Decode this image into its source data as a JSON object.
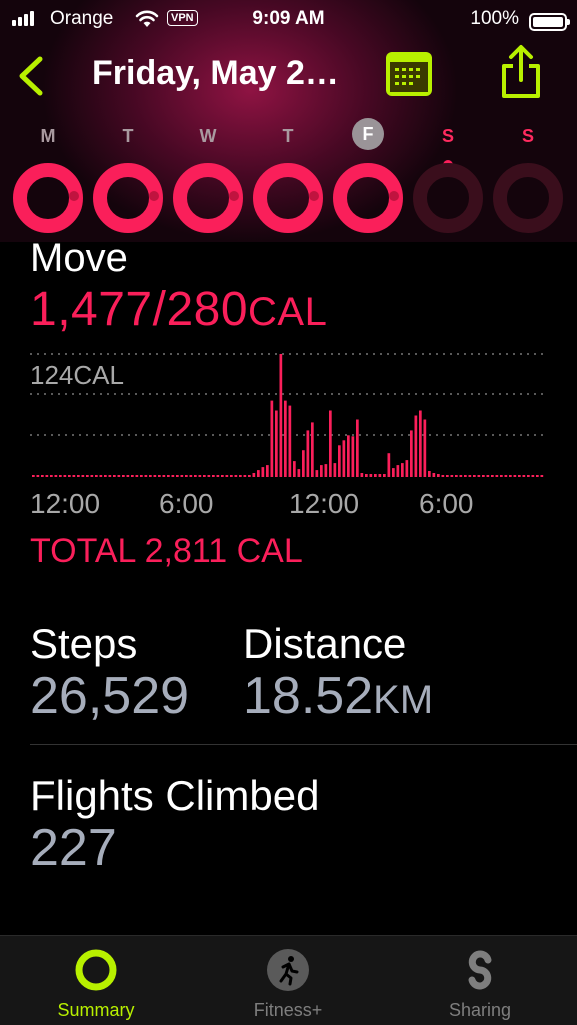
{
  "status_bar": {
    "carrier": "Orange",
    "vpn": "VPN",
    "time": "9:09 AM",
    "battery": "100%"
  },
  "nav": {
    "title": "Friday, May 2…"
  },
  "week": {
    "days": [
      "M",
      "T",
      "W",
      "T",
      "F",
      "S",
      "S"
    ],
    "ring_progress": [
      1,
      1,
      1,
      1,
      1,
      0,
      0
    ],
    "selected_index": 4,
    "colors": {
      "ring": "#fa1f5a",
      "ring_empty": "#3a0e1c"
    }
  },
  "move": {
    "title": "Move",
    "value": "1,477/280",
    "unit": "CAL",
    "chart_max_label": "124CAL",
    "x_labels": [
      "12:00",
      "6:00",
      "12:00",
      "6:00"
    ],
    "total": "TOTAL 2,811 CAL"
  },
  "chart_data": {
    "type": "bar",
    "title": "",
    "ylabel": "",
    "xlabel": "",
    "y_max_label": "124CAL",
    "ylim": [
      0,
      124
    ],
    "x_tick_labels": [
      "12:00",
      "6:00",
      "12:00",
      "6:00"
    ],
    "values": [
      2,
      2,
      2,
      2,
      2,
      2,
      2,
      2,
      2,
      2,
      2,
      2,
      2,
      2,
      2,
      2,
      2,
      2,
      2,
      2,
      2,
      2,
      2,
      2,
      2,
      2,
      2,
      2,
      2,
      2,
      2,
      2,
      2,
      2,
      2,
      2,
      2,
      2,
      2,
      2,
      2,
      2,
      2,
      2,
      2,
      2,
      2,
      2,
      2,
      4,
      7,
      10,
      12,
      77,
      67,
      124,
      77,
      72,
      16,
      8,
      27,
      47,
      55,
      7,
      12,
      13,
      67,
      14,
      32,
      37,
      42,
      41,
      58,
      4,
      3,
      3,
      3,
      3,
      3,
      24,
      9,
      12,
      14,
      17,
      47,
      62,
      67,
      58,
      6,
      4,
      3,
      2,
      2,
      2,
      2,
      2,
      2,
      2,
      2,
      2,
      2,
      2,
      2,
      2,
      2,
      2,
      2,
      2,
      2,
      2,
      2,
      2,
      2,
      2
    ],
    "color": "#fa1f5a"
  },
  "activity": {
    "steps_label": "Steps",
    "steps_value": "26,529",
    "distance_label": "Distance",
    "distance_value": "18.52",
    "distance_unit": "KM",
    "flights_label": "Flights Climbed",
    "flights_value": "227"
  },
  "tabs": [
    {
      "label": "Summary",
      "icon": "summary-ring-icon",
      "active": true
    },
    {
      "label": "Fitness+",
      "icon": "running-person-icon",
      "active": false
    },
    {
      "label": "Sharing",
      "icon": "sharing-icon",
      "active": false
    }
  ],
  "colors": {
    "accent": "#b8f000",
    "move": "#fa1f5a",
    "value_gray": "#a6adbb"
  }
}
